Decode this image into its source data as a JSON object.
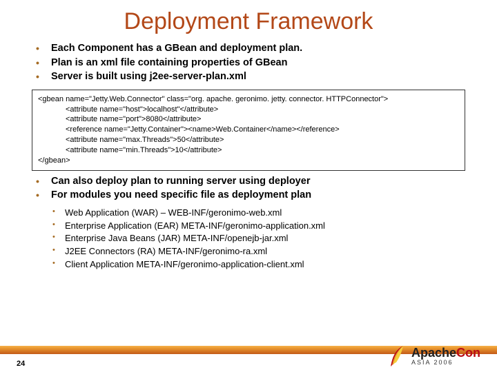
{
  "title": "Deployment Framework",
  "bullets_top": [
    "Each Component has a GBean and deployment plan.",
    "Plan is an xml file containing properties of GBean",
    "Server is built using j2ee-server-plan.xml"
  ],
  "code": {
    "l0": "<gbean name=\"Jetty.Web.Connector\" class=\"org. apache. geronimo. jetty. connector. HTTPConnector\">",
    "l1": "<attribute name=\"host\">localhost\"</attribute>",
    "l2": "<attribute name=\"port\">8080</attribute>",
    "l3": "<reference name=\"Jetty.Container\"><name>Web.Container</name></reference>",
    "l4": "<attribute name=\"max.Threads\">50</attribute>",
    "l5": "<attribute name=\"min.Threads\">10</attribute>",
    "l6": "</gbean>"
  },
  "bullets_mid": [
    "Can also deploy plan to running server using deployer",
    "For modules you need specific file as deployment plan"
  ],
  "bullets_sub": [
    "Web Application (WAR)  –  WEB-INF/geronimo-web.xml",
    "Enterprise Application (EAR) META-INF/geronimo-application.xml",
    "Enterprise Java Beans (JAR) META-INF/openejb-jar.xml",
    "J2EE Connectors (RA) META-INF/geronimo-ra.xml",
    "Client Application META-INF/geronimo-application-client.xml"
  ],
  "page_number": "24",
  "logo": {
    "brand_dark": "Apache",
    "brand_red": "Con",
    "sub": "ASIA 2006"
  }
}
